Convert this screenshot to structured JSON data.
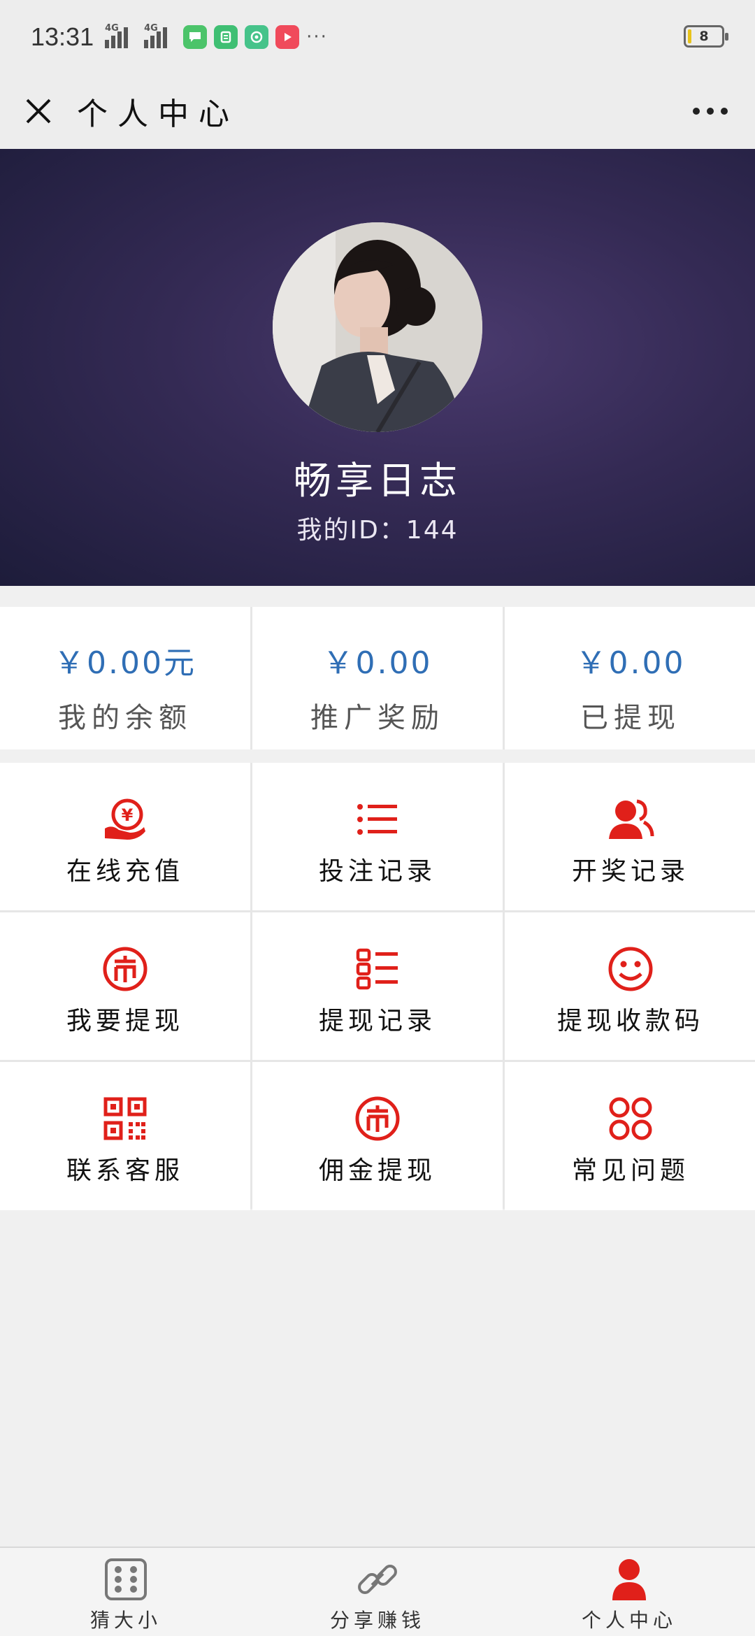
{
  "status_bar": {
    "time": "13:31",
    "network_1": "4G",
    "network_2": "4G",
    "more": "···",
    "battery": "8"
  },
  "title_bar": {
    "title": "个人中心"
  },
  "profile": {
    "username": "畅享日志",
    "id_label": "我的ID：144"
  },
  "stats": [
    {
      "value": "￥0.00元",
      "label": "我的余额"
    },
    {
      "value": "￥0.00",
      "label": "推广奖励"
    },
    {
      "value": "￥0.00",
      "label": "已提现"
    }
  ],
  "menu": [
    {
      "label": "在线充值",
      "icon": "recharge-icon"
    },
    {
      "label": "投注记录",
      "icon": "list-icon"
    },
    {
      "label": "开奖记录",
      "icon": "users-icon"
    },
    {
      "label": "我要提现",
      "icon": "coin-icon"
    },
    {
      "label": "提现记录",
      "icon": "record-list-icon"
    },
    {
      "label": "提现收款码",
      "icon": "smile-icon"
    },
    {
      "label": "联系客服",
      "icon": "qrcode-icon"
    },
    {
      "label": "佣金提现",
      "icon": "coin-icon"
    },
    {
      "label": "常见问题",
      "icon": "grid-circles-icon"
    }
  ],
  "tabs": [
    {
      "label": "猜大小",
      "icon": "dice-icon"
    },
    {
      "label": "分享赚钱",
      "icon": "link-icon"
    },
    {
      "label": "个人中心",
      "icon": "person-icon",
      "active": true
    }
  ],
  "colors": {
    "accent_red": "#e0201a",
    "stat_blue": "#2f6eb5",
    "header_dark": "#2a2449"
  }
}
